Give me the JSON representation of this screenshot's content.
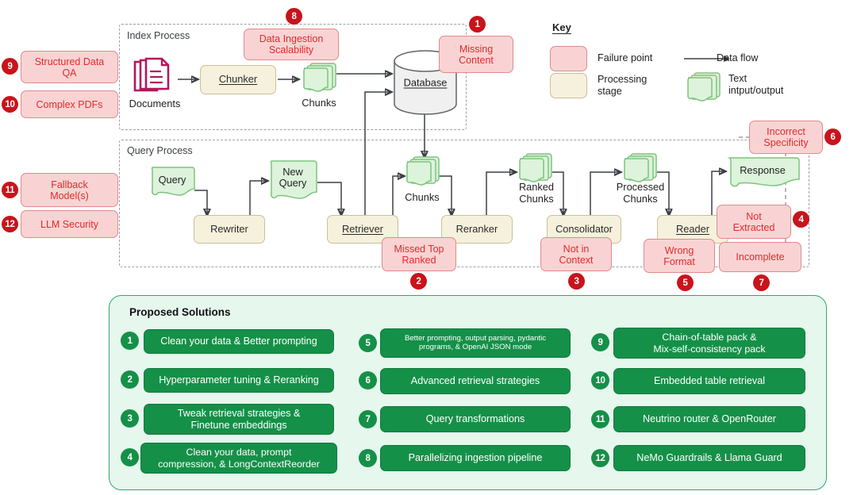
{
  "colors": {
    "failure_fill": "#f9d3d3",
    "failure_border": "#e08a8a",
    "failure_text": "#e02b2b",
    "stage_fill": "#f5f1dc",
    "stage_border": "#c9c09a",
    "text_io_fill": "#ddf3dc",
    "text_io_border": "#7cc47c",
    "badge_red": "#c8141b",
    "solution_green": "#159048",
    "solution_panel_bg": "#e6f7ee",
    "documents_icon": "#b5175b"
  },
  "index_process": {
    "label": "Index Process",
    "documents_label": "Documents",
    "chunker_label": "Chunker",
    "chunks_label": "Chunks",
    "database_label": "Database"
  },
  "query_process": {
    "label": "Query Process",
    "query_label": "Query",
    "rewriter_label": "Rewriter",
    "new_query_label": "New\nQuery",
    "retriever_label": "Retriever",
    "chunks_label": "Chunks",
    "reranker_label": "Reranker",
    "ranked_chunks_label": "Ranked\nChunks",
    "consolidator_label": "Consolidator",
    "processed_chunks_label": "Processed\nChunks",
    "reader_label": "Reader",
    "response_label": "Response"
  },
  "failure_points": {
    "data_ingestion_scalability": "Data Ingestion\nScalability",
    "missing_content": "Missing\nContent",
    "structured_data_qa": "Structured Data\nQA",
    "complex_pdfs": "Complex PDFs",
    "fallback_models": "Fallback\nModel(s)",
    "llm_security": "LLM Security",
    "missed_top_ranked": "Missed Top\nRanked",
    "not_in_context": "Not in\nContext",
    "wrong_format": "Wrong\nFormat",
    "incomplete": "Incomplete",
    "not_extracted": "Not\nExtracted",
    "incorrect_specificity": "Incorrect\nSpecificity"
  },
  "badges": {
    "b1": "1",
    "b2": "2",
    "b3": "3",
    "b4": "4",
    "b5": "5",
    "b6": "6",
    "b7": "7",
    "b8": "8",
    "b9": "9",
    "b10": "10",
    "b11": "11",
    "b12": "12"
  },
  "key": {
    "title": "Key",
    "failure_point": "Failure point",
    "processing_stage": "Processing\nstage",
    "data_flow": "Data flow",
    "text_io": "Text\nintput/output"
  },
  "solutions": {
    "title": "Proposed Solutions",
    "items": [
      {
        "num": "1",
        "text": "Clean your data & Better prompting"
      },
      {
        "num": "2",
        "text": "Hyperparameter tuning & Reranking"
      },
      {
        "num": "3",
        "text": "Tweak retrieval strategies &\nFinetune embeddings"
      },
      {
        "num": "4",
        "text": "Clean your data, prompt\ncompression, & LongContextReorder"
      },
      {
        "num": "5",
        "text": "Better prompting, output parsing, pydantic\nprograms, & OpenAI JSON mode"
      },
      {
        "num": "6",
        "text": "Advanced retrieval strategies"
      },
      {
        "num": "7",
        "text": "Query transformations"
      },
      {
        "num": "8",
        "text": "Parallelizing ingestion pipeline"
      },
      {
        "num": "9",
        "text": "Chain-of-table pack &\nMix-self-consistency pack"
      },
      {
        "num": "10",
        "text": "Embedded table retrieval"
      },
      {
        "num": "11",
        "text": "Neutrino router & OpenRouter"
      },
      {
        "num": "12",
        "text": "NeMo Guardrails & Llama Guard"
      }
    ]
  }
}
